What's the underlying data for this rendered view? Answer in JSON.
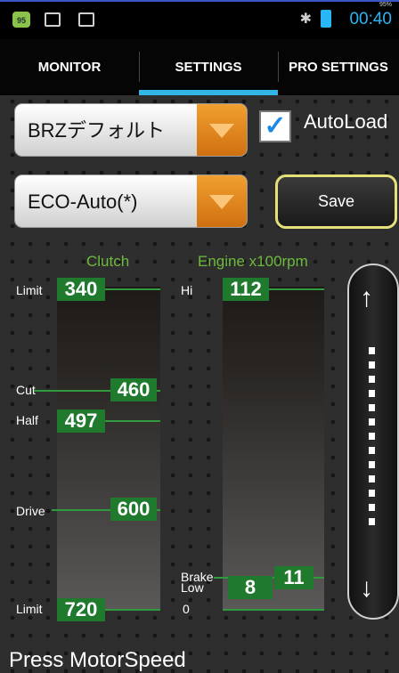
{
  "status_bar": {
    "notification_badge": "95",
    "battery_percent": "95%",
    "clock": "00:40",
    "icons": [
      "android-badge-icon",
      "image-icon",
      "screen-icon",
      "bluetooth-icon",
      "battery-icon"
    ]
  },
  "tabs": [
    {
      "label": "MONITOR",
      "selected": false
    },
    {
      "label": "SETTINGS",
      "selected": true
    },
    {
      "label": "PRO SETTINGS",
      "selected": false
    }
  ],
  "profile_spinner": {
    "value": "BRZデフォルト"
  },
  "mode_spinner": {
    "value": "ECO-Auto(*)"
  },
  "autoload": {
    "label": "AutoLoad",
    "checked": true
  },
  "save_button": {
    "label": "Save"
  },
  "clutch": {
    "title": "Clutch",
    "limit_top": {
      "label": "Limit",
      "value": "340"
    },
    "cut": {
      "label": "Cut",
      "value": "460"
    },
    "half": {
      "label": "Half",
      "value": "497"
    },
    "drive": {
      "label": "Drive",
      "value": "600"
    },
    "limit_bottom": {
      "label": "Limit",
      "value": "720"
    }
  },
  "engine": {
    "title": "Engine x100rpm",
    "hi": {
      "label": "Hi",
      "value": "112"
    },
    "brake": {
      "label": "Brake",
      "value": "11"
    },
    "low": {
      "label": "Low",
      "value": "8"
    },
    "zero": {
      "label": "0"
    }
  },
  "footer": {
    "text": "Press MotorSpeed"
  },
  "colors": {
    "accent": "#33b5e5",
    "value_green": "#1f7a2e",
    "title_green": "#6dbb3c",
    "save_border": "#e6e07a",
    "spinner_arrow": "#e68a1f"
  }
}
